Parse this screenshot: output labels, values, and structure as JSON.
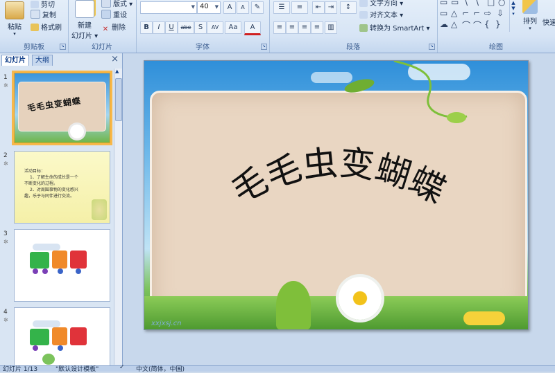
{
  "ribbon": {
    "clipboard": {
      "paste": "粘贴",
      "cut": "剪切",
      "copy": "复制",
      "format_painter": "格式刷",
      "group": "剪贴板"
    },
    "slides": {
      "new_slide": "新建",
      "new_slide_line2": "幻灯片",
      "layout": "版式",
      "reset": "重设",
      "delete": "删除",
      "group": "幻灯片"
    },
    "font": {
      "font_name": "",
      "font_size": "40",
      "grow": "A",
      "shrink": "A",
      "bold": "B",
      "italic": "I",
      "underline": "U",
      "strike": "abe",
      "shadow": "S",
      "spacing": "AV",
      "case": "Aa",
      "color": "A",
      "group": "字体"
    },
    "paragraph": {
      "text_direction": "文字方向",
      "align_text": "对齐文本",
      "convert_smartart": "转换为 SmartArt",
      "group": "段落"
    },
    "drawing": {
      "arrange": "排列",
      "quick_styles": "快速",
      "group": "绘图"
    }
  },
  "pane": {
    "tab_slides": "幻灯片",
    "tab_outline": "大纲",
    "close": "×",
    "slides": [
      {
        "num": "1",
        "title": "毛毛虫变蝴蝶"
      },
      {
        "num": "2",
        "line1": "活动目标：",
        "line2": "1、了解生命的成长是一个",
        "line3": "不断变化的过程。",
        "line4": "2、对周围事物的变化感兴",
        "line5": "趣，乐于与同伴进行交流。"
      },
      {
        "num": "3"
      },
      {
        "num": "4"
      }
    ]
  },
  "slide": {
    "title": "毛毛虫变蝴蝶",
    "watermark": "xxjxsj.cn"
  },
  "status": {
    "slide_count": "幻灯片 1/13",
    "theme": "\"默认设计模板\"",
    "language": "中文(简体，中国)"
  }
}
